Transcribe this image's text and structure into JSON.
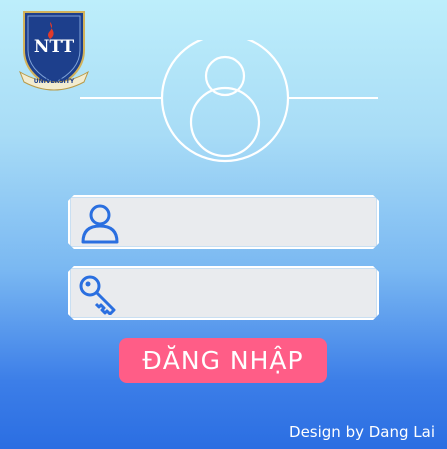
{
  "logo": {
    "name": "NTT University",
    "monogram": "NTT",
    "ribbon": "UNIVERSITY"
  },
  "username_field": {
    "value": "",
    "placeholder": "",
    "icon": "user-icon"
  },
  "password_field": {
    "value": "",
    "placeholder": "",
    "icon": "key-icon"
  },
  "login_button": {
    "label": "ĐĂNG NHẬP",
    "color": "#ff5d87"
  },
  "footer": {
    "credit": "Design by Dang Lai"
  },
  "colors": {
    "bg_top": "#bdeefb",
    "bg_bottom": "#2b6ee2",
    "icon": "#2a6fe0"
  }
}
